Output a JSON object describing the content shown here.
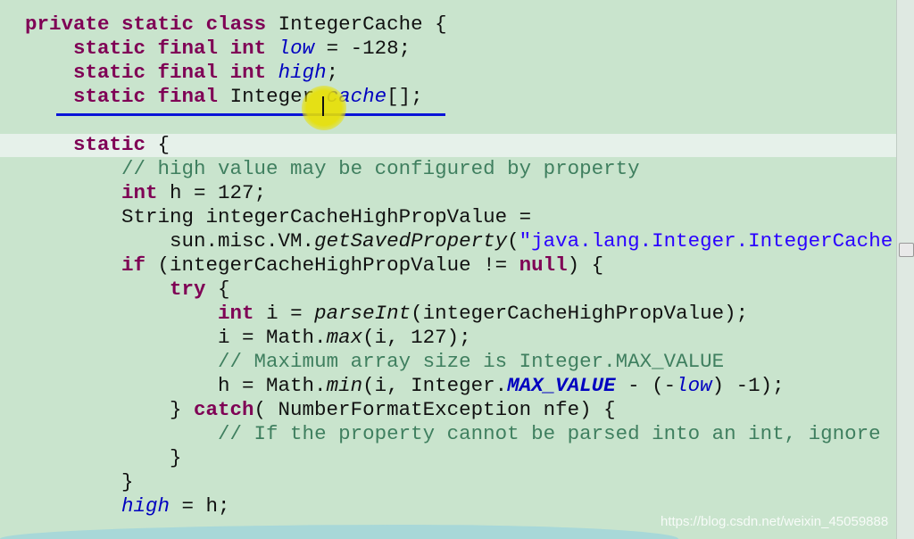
{
  "colors": {
    "background": "#c9e4cd",
    "keyword": "#7f0055",
    "field": "#0000c0",
    "comment": "#3f7f5f",
    "string": "#2a00ff",
    "current_line": "#e6f1ea"
  },
  "cursor": {
    "icon": "text-cursor-icon",
    "highlight": "yellow-circle"
  },
  "watermark": "https://blog.csdn.net/weixin_45059888",
  "code_lines": [
    [
      [
        "kw",
        "private"
      ],
      [
        "p",
        " "
      ],
      [
        "kw",
        "static"
      ],
      [
        "p",
        " "
      ],
      [
        "kw",
        "class"
      ],
      [
        "p",
        " IntegerCache {"
      ]
    ],
    [
      [
        "p",
        "    "
      ],
      [
        "kw",
        "static"
      ],
      [
        "p",
        " "
      ],
      [
        "kw",
        "final"
      ],
      [
        "p",
        " "
      ],
      [
        "kw",
        "int"
      ],
      [
        "p",
        " "
      ],
      [
        "fld",
        "low"
      ],
      [
        "p",
        " = -128;"
      ]
    ],
    [
      [
        "p",
        "    "
      ],
      [
        "kw",
        "static"
      ],
      [
        "p",
        " "
      ],
      [
        "kw",
        "final"
      ],
      [
        "p",
        " "
      ],
      [
        "kw",
        "int"
      ],
      [
        "p",
        " "
      ],
      [
        "fld",
        "high"
      ],
      [
        "p",
        ";"
      ]
    ],
    [
      [
        "p",
        "    "
      ],
      [
        "kw",
        "static"
      ],
      [
        "p",
        " "
      ],
      [
        "kw",
        "final"
      ],
      [
        "p",
        " Integer "
      ],
      [
        "fld",
        "cache"
      ],
      [
        "p",
        "[];"
      ]
    ],
    [],
    [
      [
        "p",
        "    "
      ],
      [
        "kw",
        "static"
      ],
      [
        "p",
        " {"
      ]
    ],
    [
      [
        "p",
        "        "
      ],
      [
        "cm",
        "// high value may be configured by property"
      ]
    ],
    [
      [
        "p",
        "        "
      ],
      [
        "kw",
        "int"
      ],
      [
        "p",
        " h = 127;"
      ]
    ],
    [
      [
        "p",
        "        String integerCacheHighPropValue ="
      ]
    ],
    [
      [
        "p",
        "            sun.misc.VM."
      ],
      [
        "mth",
        "getSavedProperty"
      ],
      [
        "p",
        "("
      ],
      [
        "str",
        "\"java.lang.Integer.IntegerCache"
      ]
    ],
    [
      [
        "p",
        "        "
      ],
      [
        "kw",
        "if"
      ],
      [
        "p",
        " (integerCacheHighPropValue != "
      ],
      [
        "kw",
        "null"
      ],
      [
        "p",
        ") {"
      ]
    ],
    [
      [
        "p",
        "            "
      ],
      [
        "kw",
        "try"
      ],
      [
        "p",
        " {"
      ]
    ],
    [
      [
        "p",
        "                "
      ],
      [
        "kw",
        "int"
      ],
      [
        "p",
        " i = "
      ],
      [
        "mth",
        "parseInt"
      ],
      [
        "p",
        "(integerCacheHighPropValue);"
      ]
    ],
    [
      [
        "p",
        "                i = Math."
      ],
      [
        "mth",
        "max"
      ],
      [
        "p",
        "(i, 127);"
      ]
    ],
    [
      [
        "p",
        "                "
      ],
      [
        "cm",
        "// Maximum array size is Integer.MAX_VALUE"
      ]
    ],
    [
      [
        "p",
        "                h = Math."
      ],
      [
        "mth",
        "min"
      ],
      [
        "p",
        "(i, Integer."
      ],
      [
        "fldb",
        "MAX_VALUE"
      ],
      [
        "p",
        " - (-"
      ],
      [
        "fld",
        "low"
      ],
      [
        "p",
        ") -1);"
      ]
    ],
    [
      [
        "p",
        "            } "
      ],
      [
        "kw",
        "catch"
      ],
      [
        "p",
        "( NumberFormatException nfe) {"
      ]
    ],
    [
      [
        "p",
        "                "
      ],
      [
        "cm",
        "// If the property cannot be parsed into an int, ignore"
      ]
    ],
    [
      [
        "p",
        "            }"
      ]
    ],
    [
      [
        "p",
        "        }"
      ]
    ],
    [
      [
        "p",
        "        "
      ],
      [
        "fld",
        "high"
      ],
      [
        "p",
        " = h;"
      ]
    ]
  ]
}
